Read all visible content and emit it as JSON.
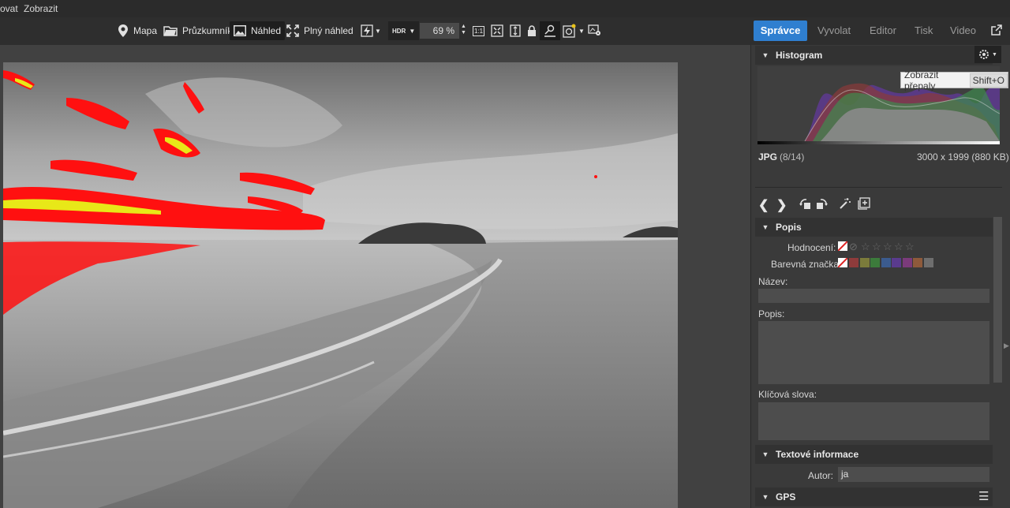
{
  "menu": {
    "items": [
      "ovat",
      "Zobrazit"
    ]
  },
  "toolbar": {
    "map": "Mapa",
    "browser": "Průzkumník",
    "preview": "Náhled",
    "full_preview": "Plný náhled",
    "hdr": "HDR",
    "zoom": "69 %",
    "one_to_one": "1:1"
  },
  "modes": {
    "manager": "Správce",
    "develop": "Vyvolat",
    "editor": "Editor",
    "print": "Tisk",
    "video": "Video"
  },
  "histogram": {
    "title": "Histogram",
    "tooltip_text": "Zobrazit přepaly",
    "tooltip_key": "Shift+O",
    "format": "JPG",
    "index": "(8/14)",
    "dimensions": "3000 x 1999 (880 KB)"
  },
  "popis": {
    "title": "Popis",
    "rating_label": "Hodnocení:",
    "color_label": "Barevná značka:",
    "name_label": "Název:",
    "desc_label": "Popis:",
    "keywords_label": "Klíčová slova:",
    "swatch_colors": [
      "#8e3b3b",
      "#7b7b3b",
      "#3c7b3b",
      "#3b5b8e",
      "#5a3b8e",
      "#7b3b7b",
      "#8e5a3b",
      "#6e6e6e",
      "#3a3a3a"
    ]
  },
  "text_info": {
    "title": "Textové informace",
    "author_label": "Autor:",
    "author_value": "ja"
  },
  "gps": {
    "title": "GPS"
  }
}
